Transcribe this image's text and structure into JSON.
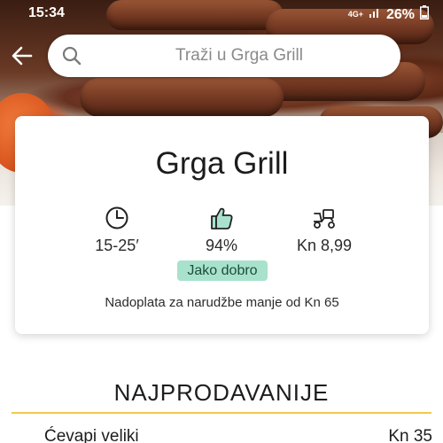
{
  "status_bar": {
    "time": "15:34",
    "network": "4G+",
    "battery": "26%"
  },
  "search": {
    "placeholder": "Traži u Grga Grill"
  },
  "restaurant": {
    "name": "Grga Grill",
    "delivery_time": "15-25′",
    "rating": "94%",
    "delivery_fee": "Kn 8,99",
    "rating_badge": "Jako dobro",
    "surcharge_note": "Nadoplata za narudžbe manje od Kn 65"
  },
  "section": {
    "title": "NAJPRODAVANIJE"
  },
  "menu_items": [
    {
      "name": "Ćevapi veliki",
      "price": "Kn 35"
    }
  ],
  "colors": {
    "accent": "#f2c94c",
    "badge_bg": "#a8e2cd",
    "badge_text": "#1e4c3c",
    "title_text": "#1c1c1c"
  },
  "icons": {
    "back": "arrow-left-icon",
    "search": "search-icon",
    "time": "clock-icon",
    "rating": "thumbs-up-icon",
    "delivery": "scooter-icon"
  }
}
